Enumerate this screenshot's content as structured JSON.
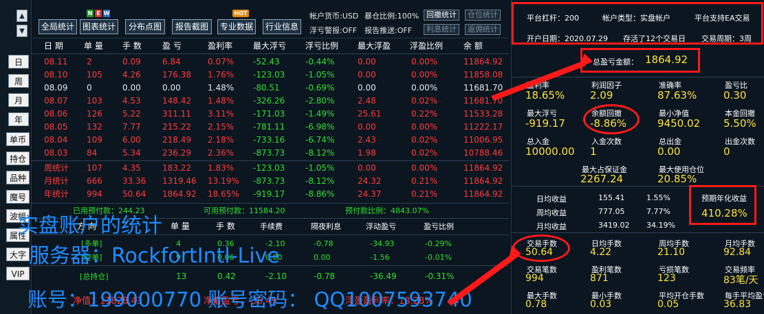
{
  "left_nav": {
    "up": "▲",
    "down": "▼",
    "period_buttons": [
      "日",
      "周",
      "月",
      "年"
    ],
    "side_buttons": [
      "单币",
      "持仓",
      "品种",
      "魔号",
      "波幅",
      "属性",
      "大字",
      "VIP"
    ]
  },
  "toolbar": {
    "buttons": [
      "全局统计",
      "图表统计",
      "分布点图",
      "报告截图",
      "专业数据",
      "行业信息"
    ],
    "badges": {
      "new": [
        "N",
        "E",
        "W"
      ],
      "hot": "HOT"
    },
    "account_currency": "帐户货币:USD",
    "hedge_ratio": "暴仓比例:100%",
    "float_alert": "浮亏警报:OFF",
    "report_push": "报告推送:OFF",
    "small_buttons": [
      "回撤统计",
      "仓位统计",
      "利息统计",
      "返佣统计"
    ]
  },
  "table": {
    "headers": [
      "日 期",
      "单 量",
      "手 数",
      "盈 亏",
      "盈利率",
      "最大浮亏",
      "浮亏比例",
      "最大浮盈",
      "浮盈比例",
      "余 额"
    ],
    "rows": [
      {
        "date": "08.11",
        "orders": "2",
        "lots": "0.09",
        "pnl": "6.84",
        "rate": "0.07%",
        "maxloss": "-52.43",
        "lossratio": "-0.44%",
        "maxgain": "0.00",
        "gainratio": "0.00%",
        "balance": "11864.92",
        "color": "red"
      },
      {
        "date": "08.10",
        "orders": "105",
        "lots": "4.26",
        "pnl": "176.38",
        "rate": "1.76%",
        "maxloss": "-123.03",
        "lossratio": "-1.05%",
        "maxgain": "0.00",
        "gainratio": "0.00%",
        "balance": "11858.08",
        "color": "red"
      },
      {
        "date": "08.09",
        "orders": "0",
        "lots": "0.00",
        "pnl": "0.00",
        "rate": "1.48%",
        "maxloss": "-80.51",
        "lossratio": "-0.69%",
        "maxgain": "0.00",
        "gainratio": "0.00%",
        "balance": "11681.70",
        "color": "white"
      },
      {
        "date": "08.07",
        "orders": "103",
        "lots": "4.53",
        "pnl": "148.42",
        "rate": "1.48%",
        "maxloss": "-326.26",
        "lossratio": "-2.80%",
        "maxgain": "2.48",
        "gainratio": "0.02%",
        "balance": "11681.70",
        "color": "red"
      },
      {
        "date": "08.06",
        "orders": "126",
        "lots": "5.22",
        "pnl": "311.11",
        "rate": "3.11%",
        "maxloss": "-171.03",
        "lossratio": "-1.49%",
        "maxgain": "25.61",
        "gainratio": "0.22%",
        "balance": "11533.28",
        "color": "red"
      },
      {
        "date": "08.05",
        "orders": "132",
        "lots": "7.77",
        "pnl": "215.22",
        "rate": "2.15%",
        "maxloss": "-781.11",
        "lossratio": "-6.98%",
        "maxgain": "0.00",
        "gainratio": "0.00%",
        "balance": "11222.17",
        "color": "red"
      },
      {
        "date": "08.04",
        "orders": "109",
        "lots": "6.00",
        "pnl": "218.49",
        "rate": "2.18%",
        "maxloss": "-733.16",
        "lossratio": "-6.74%",
        "maxgain": "2.43",
        "gainratio": "0.02%",
        "balance": "11006.95",
        "color": "red"
      },
      {
        "date": "08.03",
        "orders": "84",
        "lots": "5.34",
        "pnl": "236.29",
        "rate": "2.36%",
        "maxloss": "-873.73",
        "lossratio": "-8.12%",
        "maxgain": "1.98",
        "gainratio": "0.02%",
        "balance": "10788.46",
        "color": "red"
      }
    ],
    "summary": [
      {
        "date": "周统计",
        "orders": "107",
        "lots": "4.35",
        "pnl": "183.22",
        "rate": "1.83%",
        "maxloss": "-123.03",
        "lossratio": "-1.05%",
        "maxgain": "0.00",
        "gainratio": "0.00%",
        "balance": "11864.92"
      },
      {
        "date": "月统计",
        "orders": "666",
        "lots": "33.36",
        "pnl": "1319.46",
        "rate": "13.19%",
        "maxloss": "-873.73",
        "lossratio": "-8.12%",
        "maxgain": "24.32",
        "gainratio": "0.21%",
        "balance": "11864.92"
      },
      {
        "date": "年统计",
        "orders": "994",
        "lots": "50.64",
        "pnl": "1864.92",
        "rate": "18.65%",
        "maxloss": "-919.17",
        "lossratio": "-8.86%",
        "maxgain": "24.37",
        "gainratio": "0.21%",
        "balance": "11864.92"
      }
    ],
    "prepay": {
      "used": "已用预付款：244.23",
      "available": "可用预付款：11584.20",
      "ratio": "预付款比例：4843.07%"
    },
    "pos_headers": [
      "方 向",
      "单 量",
      "手 数",
      "手续费",
      "隔夜利息",
      "浮动盈亏",
      "盈亏比例"
    ],
    "positions": [
      {
        "dir": "[多单]",
        "orders": "4",
        "lots": "0.36",
        "fee": "-2.10",
        "swap": "-0.78",
        "float": "-34.93",
        "ratio": "-0.29%"
      },
      {
        "dir": "[空单]",
        "orders": "9",
        "lots": "0.06",
        "fee": "0.00",
        "swap": "0.00",
        "float": "-1.56",
        "ratio": "-0.01%"
      }
    ],
    "pos_total": {
      "dir": "[总持仓]",
      "orders": "13",
      "lots": "0.42",
      "fee": "-2.10",
      "swap": "-0.78",
      "float": "-36.49",
      "ratio": "-0.31%"
    },
    "footer": {
      "net": "净值：11828.43",
      "netratio": "净值盈亏：-36.49",
      "float": "浮盈盈利率：18.28%"
    }
  },
  "overlay_text": {
    "line1": "实盘账户的统计",
    "line2": "服务器：RockfortIntl-Live",
    "line3": "账号：199000770   账号密码： QQ1007593740"
  },
  "right": {
    "leverage": "平台杠杆：200",
    "account_type": "帐户类型：实盘帐户",
    "ea_support": "平台支持EA交易",
    "open_date": "开户日期：2020.07.29",
    "alive": "存活了12个交易日",
    "period": "交易周期：3周",
    "total_pnl_label": "总盈亏金额：",
    "total_pnl_value": "1864.92",
    "stats": [
      [
        {
          "l": "盈利率",
          "v": "18.65%"
        },
        {
          "l": "利润因子",
          "v": "2.09"
        },
        {
          "l": "准确率",
          "v": "87.63%"
        },
        {
          "l": "盈亏比",
          "v": "0.30"
        }
      ],
      [
        {
          "l": "最大浮亏",
          "v": "-919.17"
        },
        {
          "l": "余额回撤",
          "v": "-8.86%"
        },
        {
          "l": "最小净值",
          "v": "9450.02"
        },
        {
          "l": "本金回撤",
          "v": "5.50%"
        }
      ],
      [
        {
          "l": "总入金",
          "v": "10000.00"
        },
        {
          "l": "入金次数",
          "v": "1"
        },
        {
          "l": "总出金",
          "v": "0.00"
        },
        {
          "l": "出金次数",
          "v": "0"
        }
      ]
    ],
    "margin_label": "最大占保证金",
    "margin_value": "2267.24",
    "maxpos_label": "最大使用仓位",
    "maxpos_value": "20.85%",
    "income": [
      {
        "l": "日均收益",
        "v": "155.41",
        "p": "1.55%"
      },
      {
        "l": "周均收益",
        "v": "777.05",
        "p": "7.77%"
      },
      {
        "l": "月均收益",
        "v": "3419.02",
        "p": "34.19%"
      }
    ],
    "annual_label": "预期年化收益",
    "annual_value": "410.28%",
    "stats2": [
      [
        {
          "l": "交易手数",
          "v": "50.64"
        },
        {
          "l": "日均手数",
          "v": "4.22"
        },
        {
          "l": "周均手数",
          "v": "21.10"
        },
        {
          "l": "月均手数",
          "v": "92.84"
        }
      ],
      [
        {
          "l": "交易笔数",
          "v": "994"
        },
        {
          "l": "盈利笔数",
          "v": "871"
        },
        {
          "l": "亏损笔数",
          "v": "123"
        },
        {
          "l": "交易频率",
          "v": "83笔/天"
        }
      ],
      [
        {
          "l": "最大手数",
          "v": "0.78"
        },
        {
          "l": "最小手数",
          "v": "0.03"
        },
        {
          "l": "平均开仓手数",
          "v": "0.05"
        },
        {
          "l": "每手平均盈亏",
          "v": "36.83"
        }
      ]
    ]
  },
  "colors": {
    "accent_red": "#ff1a1a",
    "overlay_blue": "#1f8cff",
    "value_yellow": "#ffe23b",
    "positive_red": "#ff3b3b",
    "negative_green": "#2fe02f"
  }
}
